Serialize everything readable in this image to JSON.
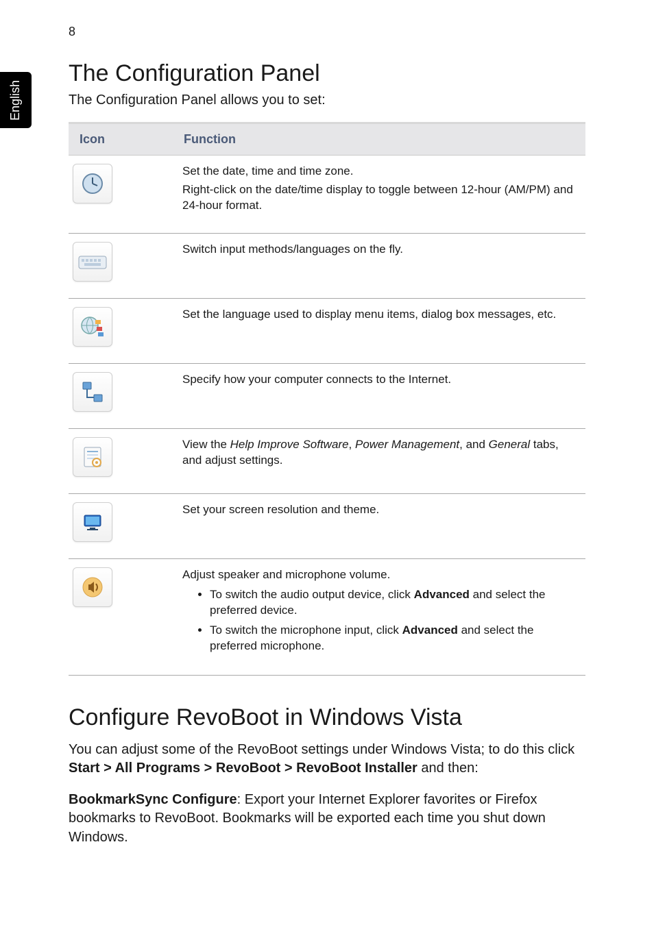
{
  "page_number": "8",
  "language_tab": "English",
  "heading1": "The Configuration Panel",
  "intro1": "The Configuration Panel allows you to set:",
  "table": {
    "header_icon": "Icon",
    "header_function": "Function",
    "rows": [
      {
        "icon_name": "clock-icon",
        "line1": "Set the date, time and time zone.",
        "line2": "Right-click on the date/time display to toggle between 12-hour (AM/PM) and 24-hour format."
      },
      {
        "icon_name": "keyboard-icon",
        "line1": "Switch input methods/languages on the fly."
      },
      {
        "icon_name": "globe-flags-icon",
        "line1": "Set the language used to display menu items, dialog box messages, etc."
      },
      {
        "icon_name": "network-icon",
        "line1": "Specify how your computer connects to the Internet."
      },
      {
        "icon_name": "settings-page-icon",
        "prefix": "View the ",
        "italic1": "Help Improve Software",
        "mid1": ", ",
        "italic2": "Power Management",
        "mid2": ", and ",
        "italic3": "General",
        "suffix": " tabs, and adjust settings."
      },
      {
        "icon_name": "monitor-icon",
        "line1": "Set your screen resolution and theme."
      },
      {
        "icon_name": "speaker-icon",
        "line1": "Adjust speaker and microphone volume.",
        "bullet1_pre": "To switch the audio output device, click ",
        "bullet1_bold": "Advanced",
        "bullet1_post": " and select the preferred device.",
        "bullet2_pre": "To switch the microphone input, click ",
        "bullet2_bold": "Advanced",
        "bullet2_post": " and select the preferred microphone."
      }
    ]
  },
  "heading2": "Configure RevoBoot in Windows Vista",
  "para2_pre": "You can adjust some of the RevoBoot settings under Windows Vista; to do this click ",
  "para2_bold": "Start > All Programs > RevoBoot > RevoBoot Installer",
  "para2_post": " and then:",
  "para3_bold": "BookmarkSync Configure",
  "para3_post": ": Export your Internet Explorer favorites or Firefox bookmarks to RevoBoot. Bookmarks will be exported each time you shut down Windows."
}
